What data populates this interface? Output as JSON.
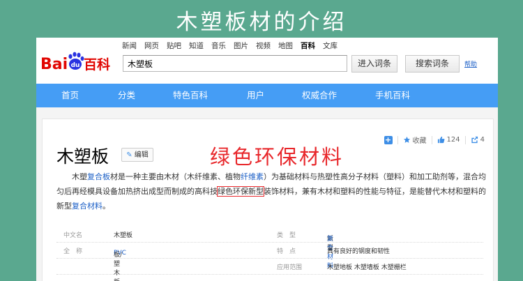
{
  "slide_title": "木塑板材的介绍",
  "logo": {
    "part1": "Bai",
    "paw": "du",
    "part2": "百科"
  },
  "nav_links": [
    "新闻",
    "网页",
    "贴吧",
    "知道",
    "音乐",
    "图片",
    "视频",
    "地图",
    "百科",
    "文库"
  ],
  "nav_active_index": 8,
  "search": {
    "value": "木塑板"
  },
  "buttons": {
    "enter": "进入词条",
    "search": "搜索词条",
    "help": "帮助"
  },
  "blue_nav": [
    "首页",
    "分类",
    "特色百科",
    "用户",
    "权威合作",
    "手机百科"
  ],
  "actions": {
    "plus": "+",
    "collect": "收藏",
    "likes": "124",
    "shares": "4"
  },
  "entry": {
    "title": "木塑板",
    "edit": "编辑"
  },
  "overlay_label": "绿色环保材料",
  "description": {
    "t1": "木塑",
    "l1": "复合板",
    "t2": "材是一种主要由木材（木纤维素、植物",
    "l2": "纤维素",
    "t3": "）为基础材料与热塑性高分子材料（塑料）和加工助剂等，混合均匀后再经模具设备加热挤出成型而制成的高科技",
    "hl": "绿色环保新型",
    "t4": "装饰材料，兼有木材和塑料的性能与特征，是能替代木材和塑料的新型",
    "l3": "复合材料",
    "t5": "。"
  },
  "info": {
    "r1": {
      "k1": "中文名",
      "v1": "木塑板",
      "k2": "类　型",
      "v2_pre": "新型",
      "v2_link": "复合材料"
    },
    "r2": {
      "k1": "全　称",
      "v1_link": "PVC",
      "v1_post": "板/塑木板",
      "k2": "特　点",
      "v2": "具有良好的钢度和韧性"
    },
    "r3": {
      "k2": "应用范围",
      "v2": "木塑地板 木塑墙板 木塑栅栏"
    }
  },
  "colors": {
    "background": "#5aa88f",
    "nav_blue": "#459df5",
    "link": "#1a5ec6",
    "highlight_red": "#e8272b"
  }
}
